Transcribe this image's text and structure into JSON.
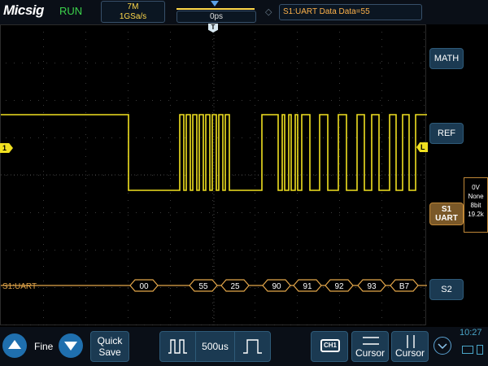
{
  "header": {
    "logo": "Micsig",
    "status": "RUN",
    "memory_depth": "7M",
    "sample_rate": "1GSa/s",
    "time_offset": "0ps",
    "trigger_info": "S1:UART Data Data=55"
  },
  "side_buttons": {
    "math": "MATH",
    "ref": "REF",
    "s1_line1": "S1",
    "s1_line2": "UART",
    "s2": "S2"
  },
  "s1_settings": {
    "threshold": "0V",
    "parity": "None",
    "bits": "8bit",
    "baud": "19.2k"
  },
  "markers": {
    "ch1": "1",
    "trigger_level": "L",
    "trigger_time": "T"
  },
  "decode": {
    "label": "S1:UART",
    "bytes": [
      "00",
      "55",
      "25",
      "90",
      "91",
      "92",
      "93",
      "B7"
    ]
  },
  "bottom": {
    "fine_label": "Fine",
    "quick_save_line1": "Quick",
    "quick_save_line2": "Save",
    "timebase": "500us",
    "ch1_label": "CH1",
    "cursor_h_label": "Cursor",
    "cursor_v_label": "Cursor",
    "clock": "10:27"
  },
  "colors": {
    "ch1": "#f0e020",
    "decode": "#e3a64a",
    "accent": "#1f6fae",
    "status": "#3bd34b"
  }
}
